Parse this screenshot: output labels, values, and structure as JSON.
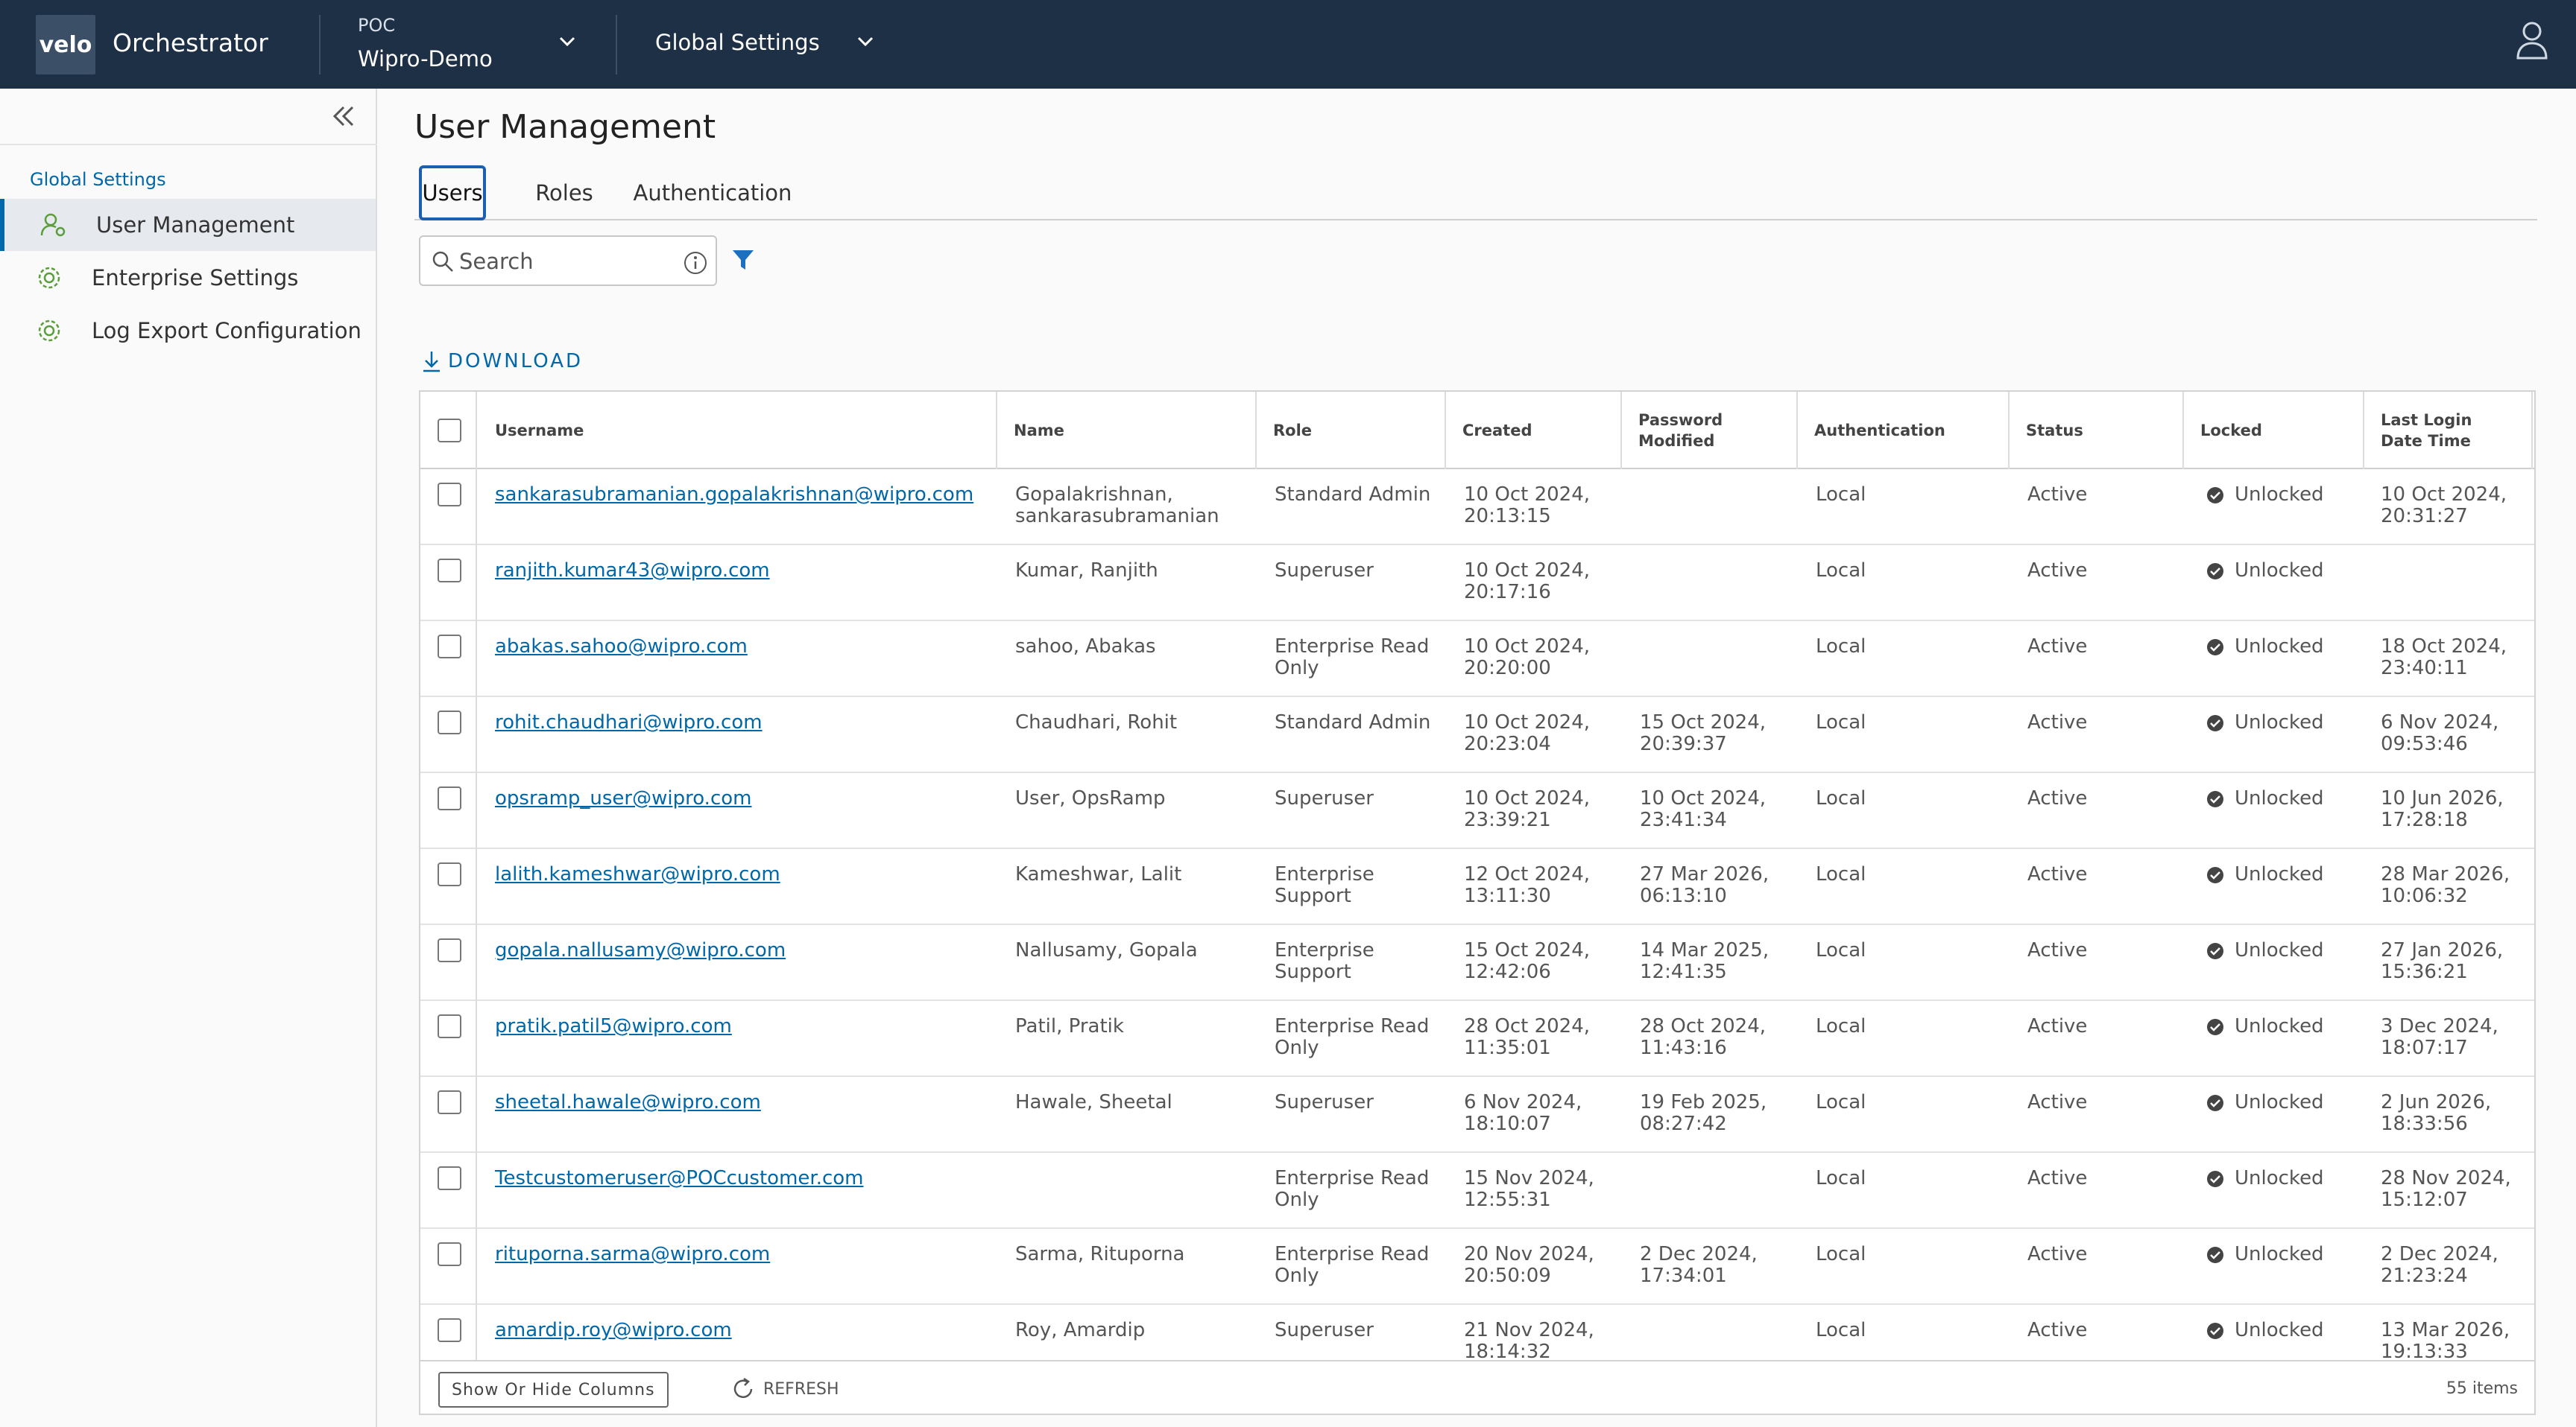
{
  "header": {
    "logo_text": "velo",
    "app_name": "Orchestrator",
    "enterprise_label": "POC",
    "enterprise_name": "Wipro-Demo",
    "section_selector": "Global Settings",
    "brand_color": "#1e3046"
  },
  "sidebar": {
    "section_title": "Global Settings",
    "items": [
      {
        "label": "User Management",
        "icon": "user-gear-icon",
        "active": true
      },
      {
        "label": "Enterprise Settings",
        "icon": "gear-icon",
        "active": false
      },
      {
        "label": "Log Export Configuration",
        "icon": "gear-icon",
        "active": false
      }
    ]
  },
  "main": {
    "title": "User Management",
    "tabs": [
      {
        "label": "Users",
        "active": true
      },
      {
        "label": "Roles",
        "active": false
      },
      {
        "label": "Authentication",
        "active": false
      }
    ],
    "search": {
      "placeholder": "Search",
      "value": ""
    },
    "download_label": "DOWNLOAD",
    "accent_color": "#0067a8"
  },
  "table": {
    "columns": [
      "Username",
      "Name",
      "Role",
      "Created",
      "Password Modified",
      "Authentication",
      "Status",
      "Locked",
      "Last Login Date Time"
    ],
    "rows": [
      {
        "username": "sankarasubramanian.gopalakrishnan@wipro.com",
        "name": [
          "Gopalakrishnan,",
          "sankarasubramanian"
        ],
        "role": [
          "Standard Admin"
        ],
        "created": [
          "10 Oct 2024,",
          "20:13:15"
        ],
        "pwd": [],
        "auth": "Local",
        "status": "Active",
        "locked": "Unlocked",
        "last": [
          "10 Oct 2024,",
          "20:31:27"
        ]
      },
      {
        "username": "ranjith.kumar43@wipro.com",
        "name": [
          "Kumar, Ranjith"
        ],
        "role": [
          "Superuser"
        ],
        "created": [
          "10 Oct 2024,",
          "20:17:16"
        ],
        "pwd": [],
        "auth": "Local",
        "status": "Active",
        "locked": "Unlocked",
        "last": []
      },
      {
        "username": "abakas.sahoo@wipro.com",
        "name": [
          "sahoo, Abakas"
        ],
        "role": [
          "Enterprise Read",
          "Only"
        ],
        "created": [
          "10 Oct 2024,",
          "20:20:00"
        ],
        "pwd": [],
        "auth": "Local",
        "status": "Active",
        "locked": "Unlocked",
        "last": [
          "18 Oct 2024,",
          "23:40:11"
        ]
      },
      {
        "username": "rohit.chaudhari@wipro.com",
        "name": [
          "Chaudhari, Rohit"
        ],
        "role": [
          "Standard Admin"
        ],
        "created": [
          "10 Oct 2024,",
          "20:23:04"
        ],
        "pwd": [
          "15 Oct 2024,",
          "20:39:37"
        ],
        "auth": "Local",
        "status": "Active",
        "locked": "Unlocked",
        "last": [
          "6 Nov 2024,",
          "09:53:46"
        ]
      },
      {
        "username": "opsramp_user@wipro.com",
        "name": [
          "User, OpsRamp"
        ],
        "role": [
          "Superuser"
        ],
        "created": [
          "10 Oct 2024,",
          "23:39:21"
        ],
        "pwd": [
          "10 Oct 2024,",
          "23:41:34"
        ],
        "auth": "Local",
        "status": "Active",
        "locked": "Unlocked",
        "last": [
          "10 Jun 2026,",
          "17:28:18"
        ]
      },
      {
        "username": "lalith.kameshwar@wipro.com",
        "name": [
          "Kameshwar, Lalit"
        ],
        "role": [
          "Enterprise",
          "Support"
        ],
        "created": [
          "12 Oct 2024,",
          "13:11:30"
        ],
        "pwd": [
          "27 Mar 2026,",
          "06:13:10"
        ],
        "auth": "Local",
        "status": "Active",
        "locked": "Unlocked",
        "last": [
          "28 Mar 2026,",
          "10:06:32"
        ]
      },
      {
        "username": "gopala.nallusamy@wipro.com",
        "name": [
          "Nallusamy, Gopala"
        ],
        "role": [
          "Enterprise",
          "Support"
        ],
        "created": [
          "15 Oct 2024,",
          "12:42:06"
        ],
        "pwd": [
          "14 Mar 2025,",
          "12:41:35"
        ],
        "auth": "Local",
        "status": "Active",
        "locked": "Unlocked",
        "last": [
          "27 Jan 2026,",
          "15:36:21"
        ]
      },
      {
        "username": "pratik.patil5@wipro.com",
        "name": [
          "Patil, Pratik"
        ],
        "role": [
          "Enterprise Read",
          "Only"
        ],
        "created": [
          "28 Oct 2024,",
          "11:35:01"
        ],
        "pwd": [
          "28 Oct 2024,",
          "11:43:16"
        ],
        "auth": "Local",
        "status": "Active",
        "locked": "Unlocked",
        "last": [
          "3 Dec 2024,",
          "18:07:17"
        ]
      },
      {
        "username": "sheetal.hawale@wipro.com",
        "name": [
          "Hawale, Sheetal"
        ],
        "role": [
          "Superuser"
        ],
        "created": [
          "6 Nov 2024,",
          "18:10:07"
        ],
        "pwd": [
          "19 Feb 2025,",
          "08:27:42"
        ],
        "auth": "Local",
        "status": "Active",
        "locked": "Unlocked",
        "last": [
          "2 Jun 2026,",
          "18:33:56"
        ]
      },
      {
        "username": "Testcustomeruser@POCcustomer.com",
        "name": [],
        "role": [
          "Enterprise Read",
          "Only"
        ],
        "created": [
          "15 Nov 2024,",
          "12:55:31"
        ],
        "pwd": [],
        "auth": "Local",
        "status": "Active",
        "locked": "Unlocked",
        "last": [
          "28 Nov 2024,",
          "15:12:07"
        ]
      },
      {
        "username": "rituporna.sarma@wipro.com",
        "name": [
          "Sarma, Rituporna"
        ],
        "role": [
          "Enterprise Read",
          "Only"
        ],
        "created": [
          "20 Nov 2024,",
          "20:50:09"
        ],
        "pwd": [
          "2 Dec 2024,",
          "17:34:01"
        ],
        "auth": "Local",
        "status": "Active",
        "locked": "Unlocked",
        "last": [
          "2 Dec 2024,",
          "21:23:24"
        ]
      },
      {
        "username": "amardip.roy@wipro.com",
        "name": [
          "Roy, Amardip"
        ],
        "role": [
          "Superuser"
        ],
        "created": [
          "21 Nov 2024,",
          "18:14:32"
        ],
        "pwd": [],
        "auth": "Local",
        "status": "Active",
        "locked": "Unlocked",
        "last": [
          "13 Mar 2026,",
          "19:13:33"
        ]
      }
    ]
  },
  "footer": {
    "show_hide_label": "Show Or Hide Columns",
    "refresh_label": "REFRESH",
    "item_count": "55 items"
  }
}
